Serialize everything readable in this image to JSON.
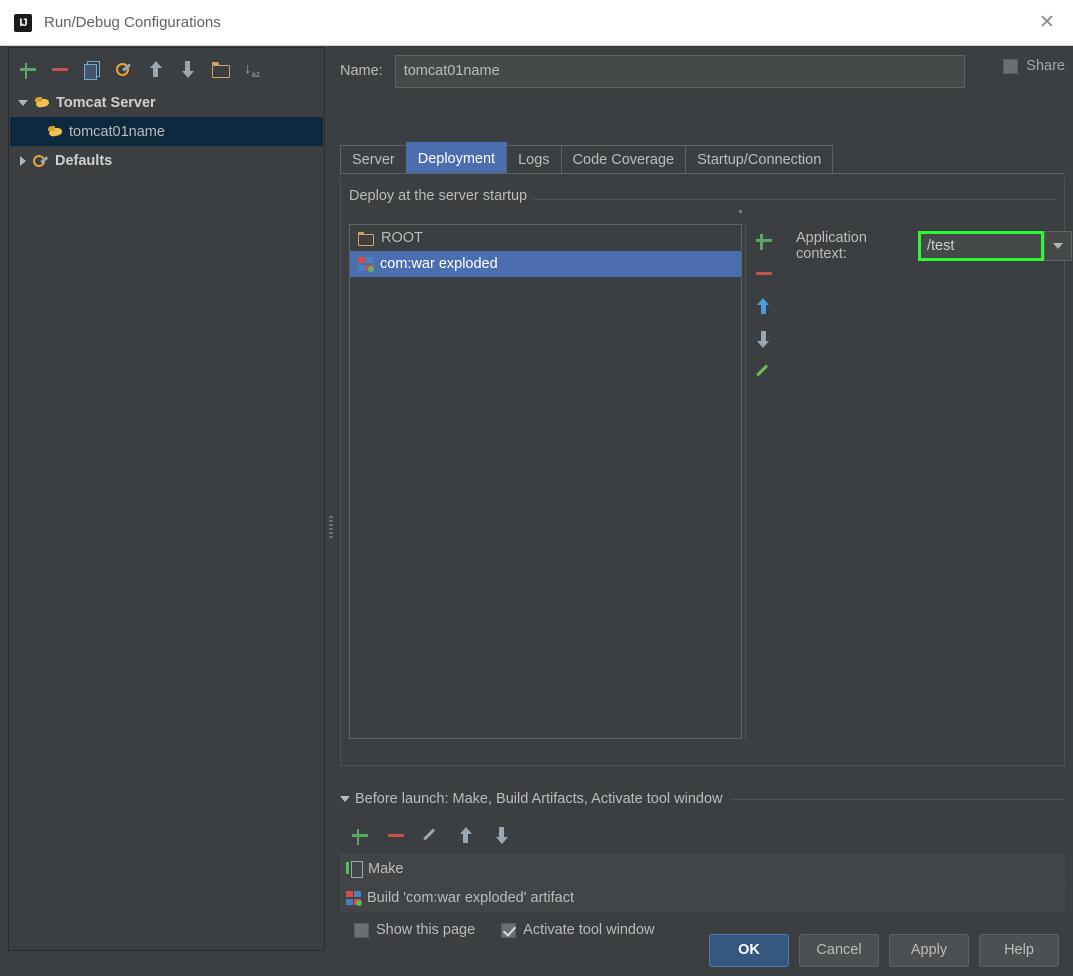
{
  "window": {
    "title": "Run/Debug Configurations",
    "logo_icon": "intellij-idea-logo",
    "close_icon": "close-icon"
  },
  "left_toolbar": {
    "items": [
      {
        "name": "add",
        "icon": "plus-icon"
      },
      {
        "name": "remove",
        "icon": "minus-icon"
      },
      {
        "name": "copy",
        "icon": "copy-icon"
      },
      {
        "name": "edit-templates",
        "icon": "wrench-icon"
      },
      {
        "name": "move-up",
        "icon": "arrow-up-icon"
      },
      {
        "name": "move-down",
        "icon": "arrow-down-icon"
      },
      {
        "name": "move-into-folder",
        "icon": "folder-icon"
      },
      {
        "name": "sort-alphabetically",
        "icon": "sort-az-icon"
      }
    ]
  },
  "tree": {
    "nodes": [
      {
        "label": "Tomcat Server",
        "icon": "tomcat-icon",
        "expanded": true,
        "selected": false
      },
      {
        "label": "tomcat01name",
        "icon": "tomcat-icon",
        "expanded": false,
        "selected": true
      },
      {
        "label": "Defaults",
        "icon": "defaults-wrench-icon",
        "expanded": false,
        "selected": false
      }
    ]
  },
  "name_field": {
    "label": "Name:",
    "label_mnemonic": "N",
    "value": "tomcat01name"
  },
  "share": {
    "label": "Share",
    "checked": false
  },
  "tabs": [
    {
      "label": "Server",
      "active": false
    },
    {
      "label": "Deployment",
      "active": true
    },
    {
      "label": "Logs",
      "active": false
    },
    {
      "label": "Code Coverage",
      "active": false
    },
    {
      "label": "Startup/Connection",
      "active": false
    }
  ],
  "deployment": {
    "group_title": "Deploy at the server startup",
    "artifacts": [
      {
        "label": "ROOT",
        "icon": "folder-icon",
        "selected": false
      },
      {
        "label": "com:war exploded",
        "icon": "artifact-icon",
        "selected": true
      }
    ],
    "side_toolbar": [
      {
        "name": "add-artifact",
        "icon": "plus-icon"
      },
      {
        "name": "remove-artifact",
        "icon": "minus-icon"
      },
      {
        "name": "move-artifact-up",
        "icon": "arrow-up-icon"
      },
      {
        "name": "move-artifact-down",
        "icon": "arrow-down-icon"
      },
      {
        "name": "edit-artifact",
        "icon": "pencil-icon"
      }
    ],
    "application_context": {
      "label": "Application context:",
      "value": "/test",
      "highlight_color": "#2dfa2d",
      "dropdown_icon": "chevron-down-icon"
    }
  },
  "before_launch": {
    "title": "Before launch: Make, Build Artifacts, Activate tool window",
    "title_mnemonic": "B",
    "toolbar": [
      {
        "name": "add-task",
        "icon": "plus-icon"
      },
      {
        "name": "remove-task",
        "icon": "minus-icon"
      },
      {
        "name": "edit-task",
        "icon": "pencil-icon"
      },
      {
        "name": "move-task-up",
        "icon": "arrow-up-icon"
      },
      {
        "name": "move-task-down",
        "icon": "arrow-down-icon"
      }
    ],
    "tasks": [
      {
        "label": "Make",
        "icon": "make-icon"
      },
      {
        "label": "Build 'com:war exploded' artifact",
        "icon": "artifact-icon"
      }
    ],
    "options": [
      {
        "label": "Show this page",
        "checked": false
      },
      {
        "label": "Activate tool window",
        "checked": true
      }
    ]
  },
  "buttons": [
    {
      "label": "OK",
      "primary": true
    },
    {
      "label": "Cancel",
      "primary": false
    },
    {
      "label": "Apply",
      "primary": false
    },
    {
      "label": "Help",
      "primary": false
    }
  ]
}
